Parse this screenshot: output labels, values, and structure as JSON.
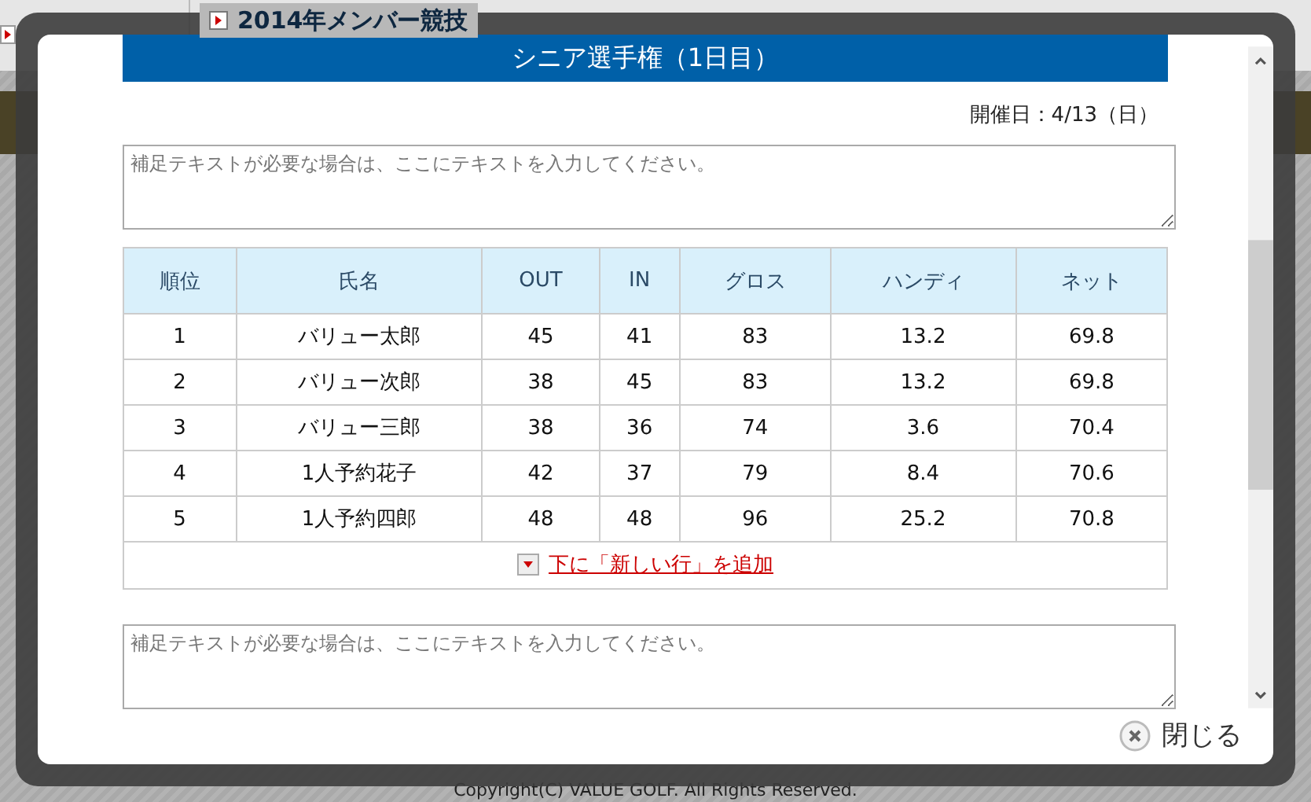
{
  "background_page": {
    "page_title": "2014年メンバー競技",
    "footer": "Copyright(C) VALUE GOLF. All Rights Reserved."
  },
  "dialog": {
    "title": "シニア選手権（1日目）",
    "date_label": "開催日：4/13（日）",
    "notes": [
      {
        "placeholder": "補足テキストが必要な場合は、ここにテキストを入力してください。"
      },
      {
        "placeholder": "補足テキストが必要な場合は、ここにテキストを入力してください。"
      }
    ],
    "table": {
      "columns": [
        "順位",
        "氏名",
        "OUT",
        "IN",
        "グロス",
        "ハンディ",
        "ネット"
      ],
      "rows": [
        [
          "1",
          "バリュー太郎",
          "45",
          "41",
          "83",
          "13.2",
          "69.8"
        ],
        [
          "2",
          "バリュー次郎",
          "38",
          "45",
          "83",
          "13.2",
          "69.8"
        ],
        [
          "3",
          "バリュー三郎",
          "38",
          "36",
          "74",
          "3.6",
          "70.4"
        ],
        [
          "4",
          "1人予約花子",
          "42",
          "37",
          "79",
          "8.4",
          "70.6"
        ],
        [
          "5",
          "1人予約四郎",
          "48",
          "48",
          "96",
          "25.2",
          "70.8"
        ]
      ]
    },
    "add_row_link": "下に「新しい行」を追加",
    "close_button": "閉じる"
  }
}
